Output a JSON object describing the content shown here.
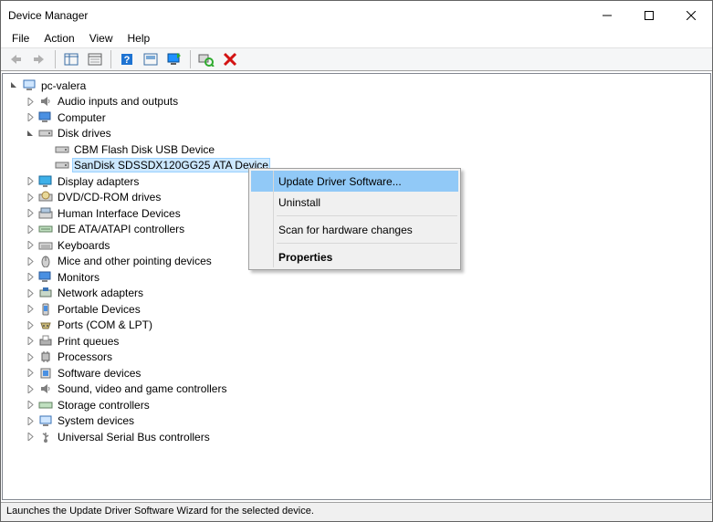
{
  "window": {
    "title": "Device Manager"
  },
  "menu": {
    "file": "File",
    "action": "Action",
    "view": "View",
    "help": "Help"
  },
  "tree": {
    "root": "pc-valera",
    "audio": "Audio inputs and outputs",
    "computer": "Computer",
    "disk_drives": "Disk drives",
    "cbm": "CBM Flash Disk USB Device",
    "sandisk": "SanDisk SDSSDX120GG25 ATA Device",
    "display": "Display adapters",
    "dvd": "DVD/CD-ROM drives",
    "hid": "Human Interface Devices",
    "ide": "IDE ATA/ATAPI controllers",
    "keyboards": "Keyboards",
    "mice": "Mice and other pointing devices",
    "monitors": "Monitors",
    "network": "Network adapters",
    "portable": "Portable Devices",
    "ports": "Ports (COM & LPT)",
    "print": "Print queues",
    "processors": "Processors",
    "software": "Software devices",
    "sound": "Sound, video and game controllers",
    "storage": "Storage controllers",
    "system": "System devices",
    "usb": "Universal Serial Bus controllers"
  },
  "context_menu": {
    "update": "Update Driver Software...",
    "uninstall": "Uninstall",
    "scan": "Scan for hardware changes",
    "properties": "Properties"
  },
  "status": "Launches the Update Driver Software Wizard for the selected device."
}
